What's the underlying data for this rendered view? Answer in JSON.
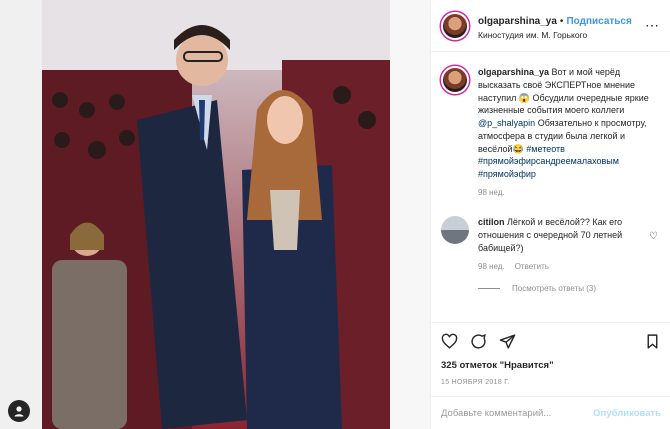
{
  "post": {
    "username": "olgaparshina_ya",
    "follow_label": "Подписаться",
    "location": "Киностудия им. М. Горького",
    "more_icon": "more-dots-icon"
  },
  "caption": {
    "username": "olgaparshina_ya",
    "text_1": "Вот и мой черёд высказать своё ЭКСПЕРТное мнение наступил 😱 Обсудили очередные яркие жизненные события моего коллеги ",
    "mention": "@p_shalyapin",
    "text_2": " Обязательно к просмотру, атмосфера в студии была легкой и весёлой😂 ",
    "hashtags": "#метеотв #прямойэфирсандреемалаховым #прямойэфир",
    "age": "98 нед."
  },
  "comment": {
    "username": "citilon",
    "text": "Лёгкой и весёлой?? Как его отношения с очередной 70 летней бабищей?)",
    "age": "98 нед.",
    "reply_label": "Ответить",
    "view_replies": "Посмотреть ответы (3)"
  },
  "engagement": {
    "likes": "325 отметок \"Нравится\"",
    "date": "15 НОЯБРЯ 2018 Г."
  },
  "add_comment": {
    "placeholder": "Добавьте комментарий...",
    "publish_label": "Опубликовать"
  },
  "colors": {
    "follow_blue": "#3897f0",
    "publish_disabled": "#b2dffc",
    "meta_gray": "#8e8e8e"
  }
}
